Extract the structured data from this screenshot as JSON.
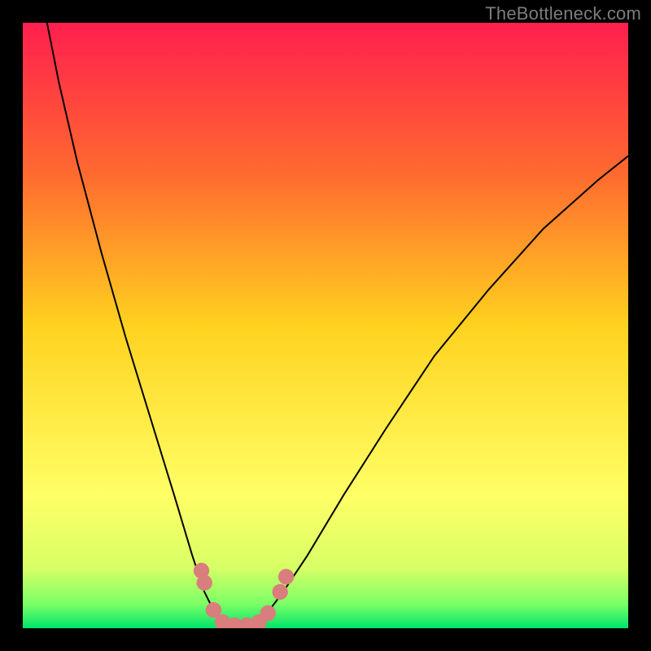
{
  "watermark": "TheBottleneck.com",
  "chart_data": {
    "type": "line",
    "title": "",
    "xlabel": "",
    "ylabel": "",
    "xlim": [
      0,
      100
    ],
    "ylim": [
      0,
      100
    ],
    "gradient_stops": [
      {
        "offset": 0,
        "color": "#ff1f4e"
      },
      {
        "offset": 25,
        "color": "#ff6a2f"
      },
      {
        "offset": 50,
        "color": "#ffd21f"
      },
      {
        "offset": 78,
        "color": "#ffff66"
      },
      {
        "offset": 90,
        "color": "#d8ff66"
      },
      {
        "offset": 96,
        "color": "#7bff66"
      },
      {
        "offset": 100,
        "color": "#00e46a"
      }
    ],
    "series": [
      {
        "name": "curve",
        "stroke": "#000000",
        "points": [
          {
            "x": 4,
            "y": 100
          },
          {
            "x": 6,
            "y": 90
          },
          {
            "x": 9,
            "y": 77
          },
          {
            "x": 13,
            "y": 62
          },
          {
            "x": 17,
            "y": 48
          },
          {
            "x": 21,
            "y": 35
          },
          {
            "x": 25,
            "y": 22
          },
          {
            "x": 28,
            "y": 12
          },
          {
            "x": 30,
            "y": 6
          },
          {
            "x": 32,
            "y": 2
          },
          {
            "x": 34,
            "y": 0.5
          },
          {
            "x": 37,
            "y": 0.5
          },
          {
            "x": 40,
            "y": 2
          },
          {
            "x": 43,
            "y": 6
          },
          {
            "x": 47,
            "y": 12
          },
          {
            "x": 53,
            "y": 22
          },
          {
            "x": 60,
            "y": 33
          },
          {
            "x": 68,
            "y": 45
          },
          {
            "x": 77,
            "y": 56
          },
          {
            "x": 86,
            "y": 66
          },
          {
            "x": 95,
            "y": 74
          },
          {
            "x": 100,
            "y": 78
          }
        ]
      },
      {
        "name": "markers",
        "fill": "#d97d7d",
        "points": [
          {
            "x": 29.5,
            "y": 9.5,
            "r": 1.3
          },
          {
            "x": 30.0,
            "y": 7.5,
            "r": 1.3
          },
          {
            "x": 31.5,
            "y": 3.0,
            "r": 1.3
          },
          {
            "x": 33.0,
            "y": 1.0,
            "r": 1.3
          },
          {
            "x": 35.0,
            "y": 0.5,
            "r": 1.3
          },
          {
            "x": 37.0,
            "y": 0.5,
            "r": 1.3
          },
          {
            "x": 39.0,
            "y": 1.0,
            "r": 1.3
          },
          {
            "x": 40.5,
            "y": 2.5,
            "r": 1.3
          },
          {
            "x": 42.5,
            "y": 6.0,
            "r": 1.3
          },
          {
            "x": 43.5,
            "y": 8.5,
            "r": 1.3
          }
        ]
      }
    ]
  }
}
